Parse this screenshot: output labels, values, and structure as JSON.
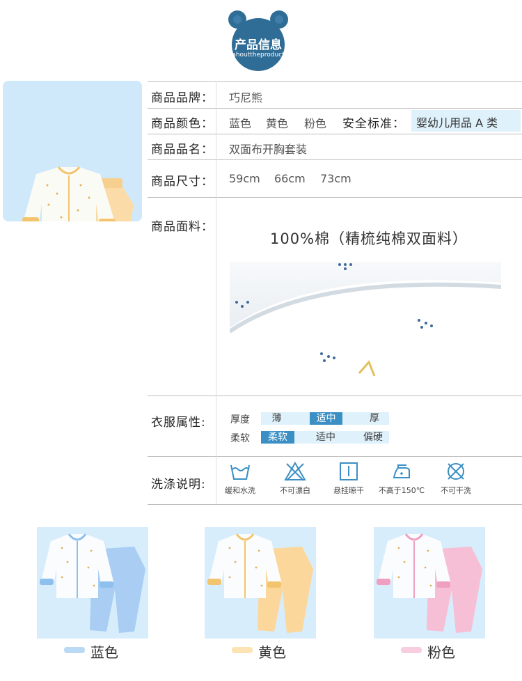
{
  "header": {
    "title": "产品信息",
    "subtitle": "ahouttheproduct",
    "badge_color": "#2f6d97"
  },
  "specs": {
    "brand_label": "商品品牌：",
    "brand_value": "巧尼熊",
    "color_label": "商品颜色：",
    "color_values": [
      "蓝色",
      "黄色",
      "粉色"
    ],
    "safety_label": "安全标准：",
    "safety_value": "婴幼儿用品 A 类",
    "name_label": "商品品名：",
    "name_value": "双面布开胸套装",
    "size_label": "商品尺寸：",
    "size_values": [
      "59cm",
      "66cm",
      "73cm"
    ],
    "fabric_label": "商品面料：",
    "fabric_title": "100%棉（精梳纯棉双面料）"
  },
  "attributes": {
    "label": "衣服属性:",
    "thickness_label": "厚度",
    "thickness_options": [
      "薄",
      "适中",
      "厚"
    ],
    "thickness_selected": 1,
    "softness_label": "柔软",
    "softness_options": [
      "柔软",
      "适中",
      "偏硬"
    ],
    "softness_selected": 0
  },
  "washing": {
    "label": "洗涤说明:",
    "items": [
      {
        "icon": "hand-wash-icon",
        "label": "缓和水洗"
      },
      {
        "icon": "no-bleach-icon",
        "label": "不可漂白"
      },
      {
        "icon": "hang-dry-icon",
        "label": "悬挂晾干"
      },
      {
        "icon": "iron-icon",
        "label": "不高于150℃"
      },
      {
        "icon": "no-dry-clean-icon",
        "label": "不可干洗"
      }
    ]
  },
  "colors": [
    {
      "name": "蓝色",
      "swatch": "#b9d9f5",
      "pants": "#a9cdf3",
      "trim": "#8ec0ee"
    },
    {
      "name": "黄色",
      "swatch": "#fbe3b2",
      "pants": "#fbd79c",
      "trim": "#f2c46d"
    },
    {
      "name": "粉色",
      "swatch": "#f8cde0",
      "pants": "#f6bfd6",
      "trim": "#ef9fc0"
    }
  ],
  "accent_color": "#3b8fc4",
  "light_panel_color": "#dff1fb"
}
